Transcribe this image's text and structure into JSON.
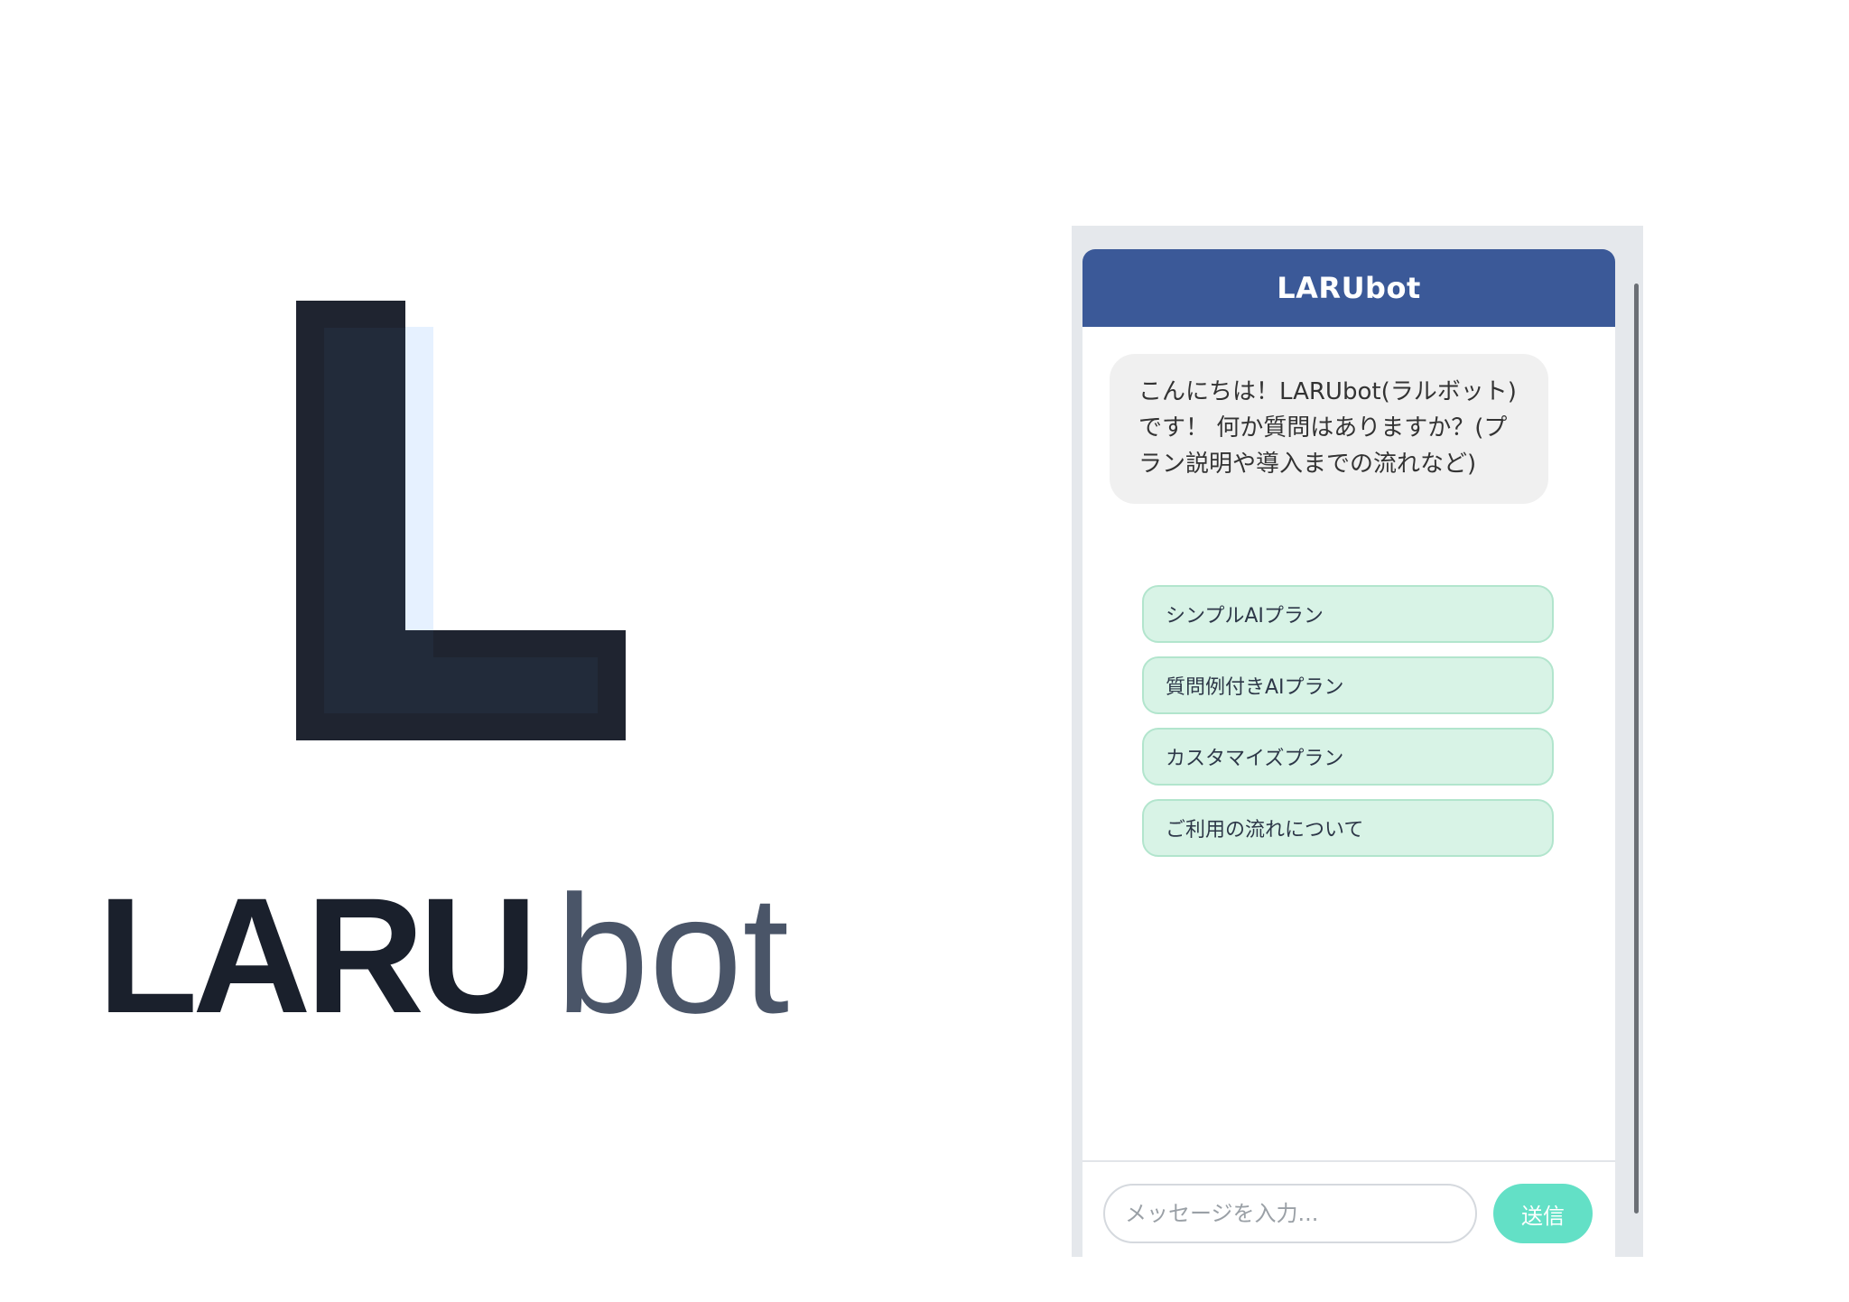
{
  "logo": {
    "word_primary": "LARU",
    "word_secondary": "bot",
    "mark_icon": "letter-l-logo-icon",
    "colors": {
      "dark": "#1f2430",
      "dark_fill": "#222b3a",
      "highlight": "#e6f1ff",
      "word_primary": "#1a202c",
      "word_secondary": "#4a5568"
    }
  },
  "chat": {
    "header_title": "LARUbot",
    "bot_message": "こんにちは！LARUbot(ラルボット)です！ 何か質問はありますか？(プラン説明や導入までの流れなど)",
    "quick_replies": [
      "シンプルAIプラン",
      "質問例付きAIプラン",
      "カスタマイズプラン",
      "ご利用の流れについて"
    ],
    "input_placeholder": "メッセージを入力...",
    "send_label": "送信",
    "colors": {
      "header": "#3b5998",
      "bubble": "#f0f0f0",
      "quick_reply": "#d8f3e6",
      "send": "#63e0c6"
    }
  }
}
